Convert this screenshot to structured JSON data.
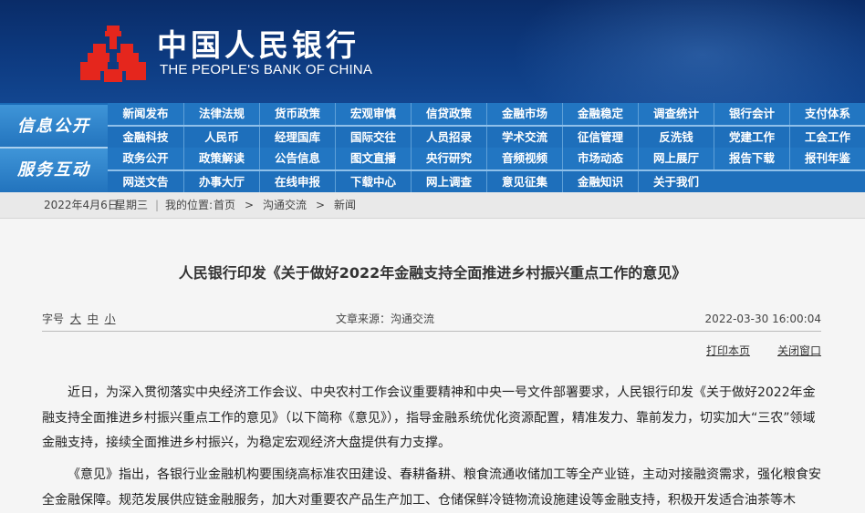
{
  "header": {
    "bank_name_cn": "中国人民银行",
    "bank_name_en": "THE PEOPLE'S BANK OF CHINA",
    "emblem_icon": "pboc-emblem-icon",
    "brand_red": "#e5261d"
  },
  "nav": {
    "section1_label": "信息公开",
    "section2_label": "服务互动",
    "row1": [
      "新闻发布",
      "法律法规",
      "货币政策",
      "宏观审慎",
      "信贷政策",
      "金融市场",
      "金融稳定",
      "调查统计",
      "银行会计",
      "支付体系"
    ],
    "row2": [
      "金融科技",
      "人民币",
      "经理国库",
      "国际交往",
      "人员招录",
      "学术交流",
      "征信管理",
      "反洗钱",
      "党建工作",
      "工会工作"
    ],
    "row3": [
      "政务公开",
      "政策解读",
      "公告信息",
      "图文直播",
      "央行研究",
      "音频视频",
      "市场动态",
      "网上展厅",
      "报告下载",
      "报刊年鉴"
    ],
    "row4": [
      "网送文告",
      "办事大厅",
      "在线申报",
      "下载中心",
      "网上调查",
      "意见征集",
      "金融知识",
      "关于我们"
    ]
  },
  "breadcrumb": {
    "date": "2022年4月6日",
    "weekday": "星期三",
    "location_prefix": "我的位置:",
    "home": "首页",
    "sep": ">",
    "level1": "沟通交流",
    "level2": "新闻"
  },
  "article": {
    "title": "人民银行印发《关于做好2022年金融支持全面推进乡村振兴重点工作的意见》",
    "font_size_label": "字号",
    "font_large": "大",
    "font_medium": "中",
    "font_small": "小",
    "source": "文章来源：沟通交流",
    "datetime": "2022-03-30 16:00:04",
    "print_label": "打印本页",
    "close_label": "关闭窗口",
    "paragraph1": "近日，为深入贯彻落实中央经济工作会议、中央农村工作会议重要精神和中央一号文件部署要求，人民银行印发《关于做好2022年金融支持全面推进乡村振兴重点工作的意见》（以下简称《意见》），指导金融系统优化资源配置，精准发力、靠前发力，切实加大“三农”领域金融支持，接续全面推进乡村振兴，为稳定宏观经济大盘提供有力支撑。",
    "paragraph2": "《意见》指出，各银行业金融机构要围绕高标准农田建设、春耕备耕、粮食流通收储加工等全产业链，主动对接融资需求，强化粮食安全金融保障。规范发展供应链金融服务，加大对重要农产品生产加工、仓储保鲜冷链物流设施建设等金融支持，积极开发适合油茶等木"
  }
}
